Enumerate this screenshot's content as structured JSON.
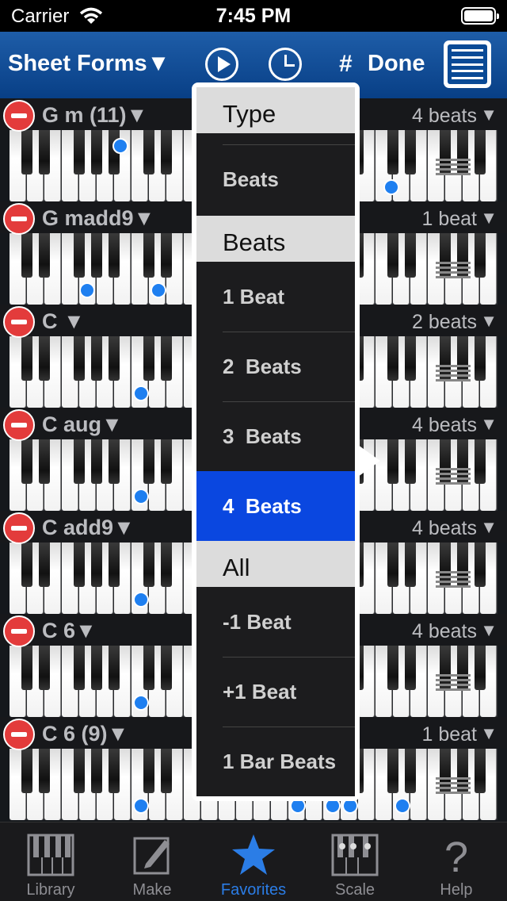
{
  "status": {
    "carrier": "Carrier",
    "time": "7:45 PM"
  },
  "nav": {
    "title": "Sheet Forms▼",
    "sharp": "#",
    "done": "Done",
    "icons": [
      "play-icon",
      "clock-icon",
      "list-icon"
    ]
  },
  "chords": [
    {
      "name": "G m (11)▼",
      "beats": "4 beats"
    },
    {
      "name": "G madd9▼",
      "beats": "1 beat"
    },
    {
      "name": "C ▼",
      "beats": "2 beats"
    },
    {
      "name": "C aug▼",
      "beats": "4 beats"
    },
    {
      "name": "C add9▼",
      "beats": "4 beats"
    },
    {
      "name": "C 6▼",
      "beats": "4 beats"
    },
    {
      "name": "C 6 (9)▼",
      "beats": "1 beat"
    }
  ],
  "beats_arrow": "▼",
  "popover": {
    "sections": [
      {
        "title": "Type",
        "items": [
          "Beats"
        ]
      },
      {
        "title": "Beats",
        "items": [
          "1 Beat",
          "2  Beats",
          "3  Beats",
          "4  Beats"
        ],
        "selected": "4  Beats"
      },
      {
        "title": "All",
        "items": [
          "-1 Beat",
          "+1 Beat",
          "1 Bar Beats"
        ]
      }
    ]
  },
  "tabs": [
    {
      "label": "Library",
      "icon": "piano-library-icon"
    },
    {
      "label": "Make",
      "icon": "pencil-icon"
    },
    {
      "label": "Favorites",
      "icon": "star-icon",
      "active": true
    },
    {
      "label": "Scale",
      "icon": "scale-icon"
    },
    {
      "label": "Help",
      "icon": "question-icon"
    }
  ],
  "colors": {
    "nav": "#0a4a96",
    "accent": "#2b7de6",
    "selected": "#0a47e0",
    "delete": "#e33b3b",
    "note": "#1e7ff0"
  }
}
